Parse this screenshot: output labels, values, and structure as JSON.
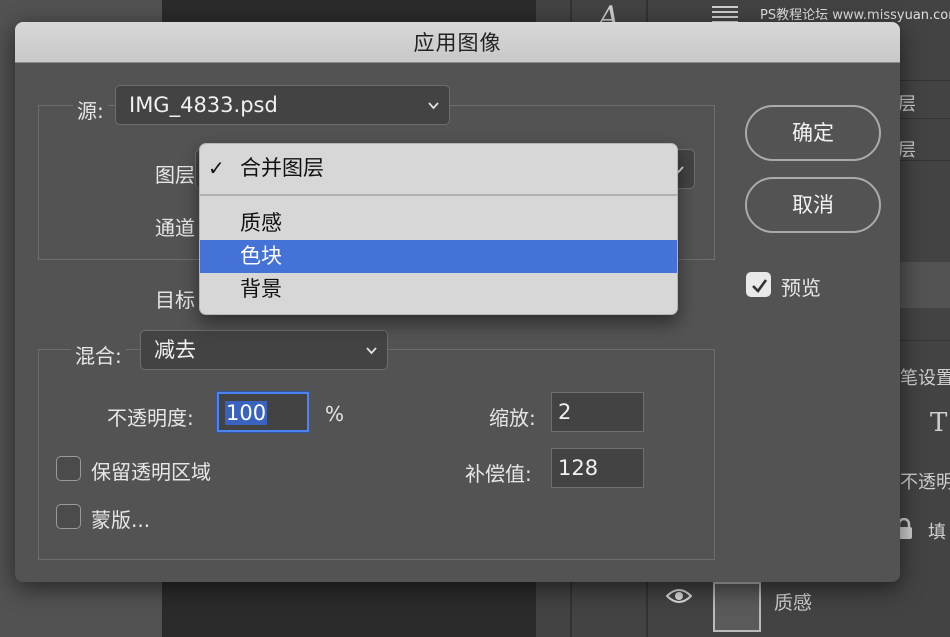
{
  "background": {
    "watermark": "PS教程论坛 www.missyuan.com",
    "right_texts": [
      "层",
      "层",
      "笔设置",
      "不透明",
      "填"
    ],
    "layer_name": "质感"
  },
  "dialog": {
    "title": "应用图像",
    "source_label": "源:",
    "source_value": "IMG_4833.psd",
    "layer_label": "图层",
    "channel_label": "通道",
    "target_label": "目标",
    "blend_label": "混合:",
    "blend_value": "减去",
    "opacity_label": "不透明度:",
    "opacity_value": "100",
    "opacity_unit": "%",
    "scale_label": "缩放:",
    "scale_value": "2",
    "offset_label": "补偿值:",
    "offset_value": "128",
    "preserve_transparency_label": "保留透明区域",
    "mask_label": "蒙版...",
    "ok_label": "确定",
    "cancel_label": "取消",
    "preview_label": "预览"
  },
  "layer_menu": {
    "checked_item": "合并图层",
    "items": [
      "质感",
      "色块",
      "背景"
    ],
    "highlighted_index": 1
  },
  "colors": {
    "highlight": "#4472d6",
    "focus_ring": "#4b83f0"
  }
}
